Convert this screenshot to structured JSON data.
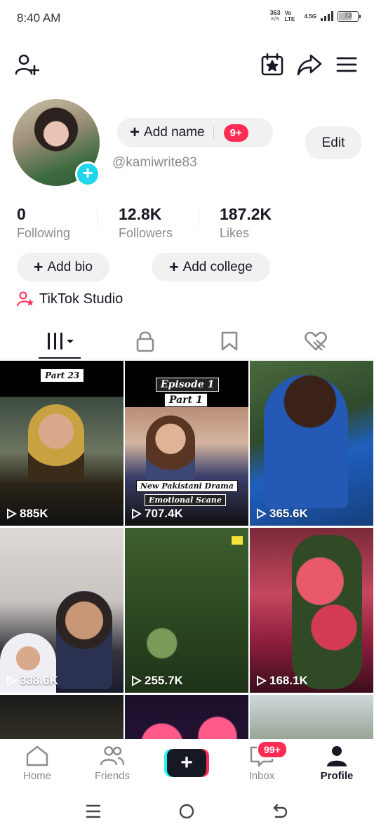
{
  "status_bar": {
    "time": "8:40 AM",
    "net_speed": "363",
    "net_unit": "K/S",
    "volte": "Vo LTE",
    "network": "4.5G",
    "battery": "73",
    "battery_level_percent": 73
  },
  "header": {
    "icons": [
      "add-friend-icon",
      "creator-calendar-icon",
      "share-icon",
      "menu-icon"
    ]
  },
  "profile": {
    "add_name_label": "Add name",
    "add_name_badge": "9+",
    "edit_label": "Edit",
    "username": "@kamiwrite83",
    "stats": [
      {
        "value": "0",
        "label": "Following"
      },
      {
        "value": "12.8K",
        "label": "Followers"
      },
      {
        "value": "187.2K",
        "label": "Likes"
      }
    ],
    "add_bio_label": "Add bio",
    "add_college_label": "Add college",
    "studio_label": "TikTok Studio"
  },
  "tabs": [
    {
      "icon": "videos-grid-icon",
      "active": true
    },
    {
      "icon": "lock-icon",
      "active": false
    },
    {
      "icon": "bookmark-icon",
      "active": false
    },
    {
      "icon": "liked-heart-icon",
      "active": false
    }
  ],
  "videos": [
    {
      "views": "885K",
      "overlay_top": "Part 23"
    },
    {
      "views": "707.4K",
      "overlay_top": "Episode 1",
      "overlay_top2": "Part 1",
      "overlay_bottom": "New Pakistani Drama",
      "overlay_bottom2": "Emotional Scane"
    },
    {
      "views": "365.6K"
    },
    {
      "views": "338.6K"
    },
    {
      "views": "255.7K"
    },
    {
      "views": "168.1K"
    },
    {
      "views": ""
    },
    {
      "views": ""
    },
    {
      "views": ""
    }
  ],
  "bottom_nav": {
    "home": "Home",
    "friends": "Friends",
    "inbox": "Inbox",
    "inbox_badge": "99+",
    "profile": "Profile",
    "create": "+"
  },
  "colors": {
    "accent_red": "#fe2c55",
    "accent_cyan": "#20d5ec",
    "pill_bg": "#f1f1f2",
    "muted_text": "#8a8b91"
  }
}
